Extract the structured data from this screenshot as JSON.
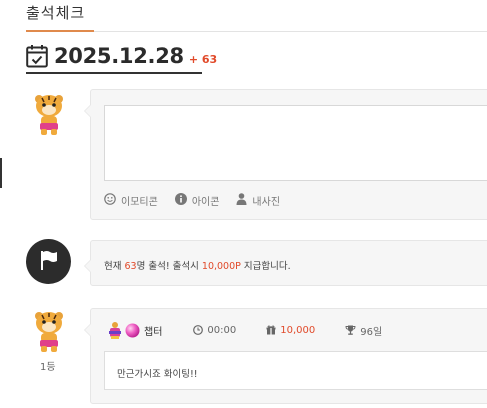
{
  "header": {
    "tab_title": "출석체크"
  },
  "date": {
    "value": "2025.12.28",
    "delta": "+ 63"
  },
  "composer": {
    "tools": [
      {
        "label": "이모티콘",
        "icon": "smile-icon"
      },
      {
        "label": "아이콘",
        "icon": "info-icon"
      },
      {
        "label": "내사진",
        "icon": "person-icon"
      }
    ]
  },
  "notice": {
    "prefix": "현재 ",
    "count": "63",
    "middle": "명 출석! 출석시 ",
    "points": "10,000P",
    "suffix": " 지급합니다."
  },
  "entry": {
    "rank": "1등",
    "nickname": "챕터",
    "time": "00:00",
    "points": "10,000",
    "days": "96일",
    "message": "만근가시죠 화이팅!!"
  },
  "colors": {
    "accent": "#e14a2a",
    "tab_underline": "#e08a4c"
  }
}
